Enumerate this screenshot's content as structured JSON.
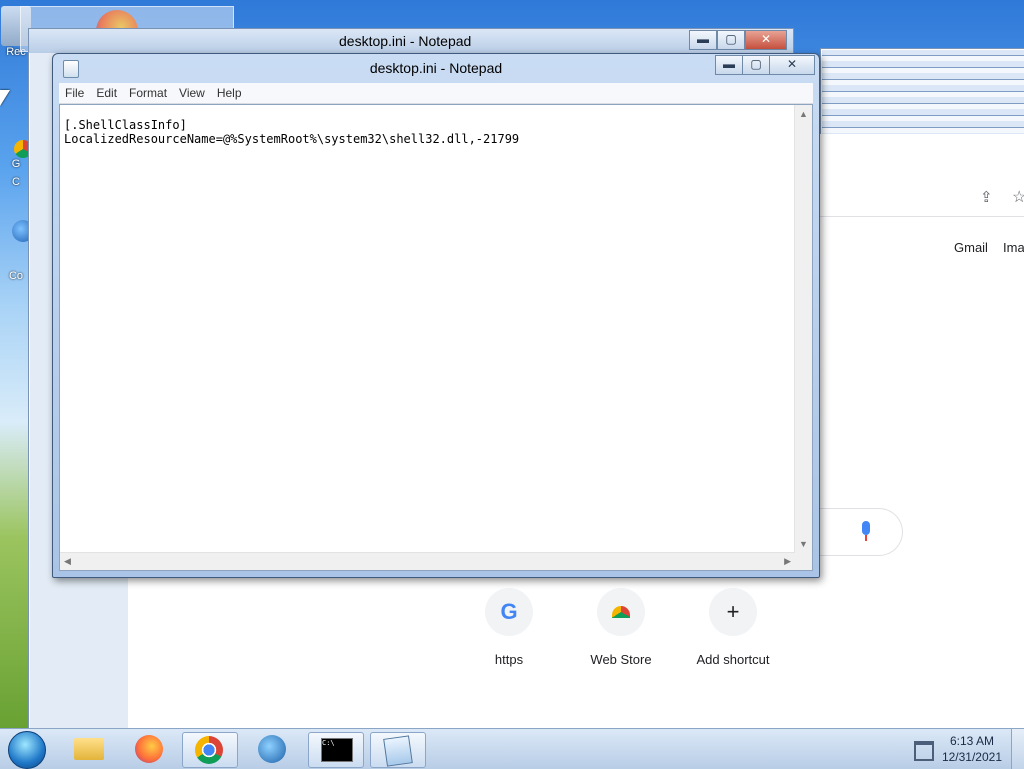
{
  "desktop": {
    "icons": [
      {
        "label": "Rec",
        "icon": "recycle-bin-icon"
      },
      {
        "label": "G",
        "icon": "chrome-icon"
      },
      {
        "label": "C",
        "icon": "chrome-icon"
      },
      {
        "label": "Co",
        "icon": "globe-icon"
      }
    ]
  },
  "background_window": {
    "title": "desktop.ini - Notepad"
  },
  "chrome": {
    "top_links": [
      "Gmail",
      "Ima"
    ],
    "shortcuts": [
      {
        "label": "https",
        "icon": "google-g-icon"
      },
      {
        "label": "Web Store",
        "icon": "web-store-icon"
      },
      {
        "label": "Add shortcut",
        "icon": "plus-icon"
      }
    ]
  },
  "notepad": {
    "title": "desktop.ini - Notepad",
    "menu": [
      "File",
      "Edit",
      "Format",
      "View",
      "Help"
    ],
    "content": "[.ShellClassInfo]\nLocalizedResourceName=@%SystemRoot%\\system32\\shell32.dll,-21799"
  },
  "taskbar": {
    "items": [
      "start-orb-icon",
      "explorer-icon",
      "firefox-icon",
      "chrome-icon",
      "network-icon",
      "cmd-icon",
      "notepad-icon"
    ],
    "time": "6:13 AM",
    "date": "12/31/2021"
  },
  "colors": {
    "accent": "#1a73e8",
    "titlebar": "#b9cde6"
  }
}
